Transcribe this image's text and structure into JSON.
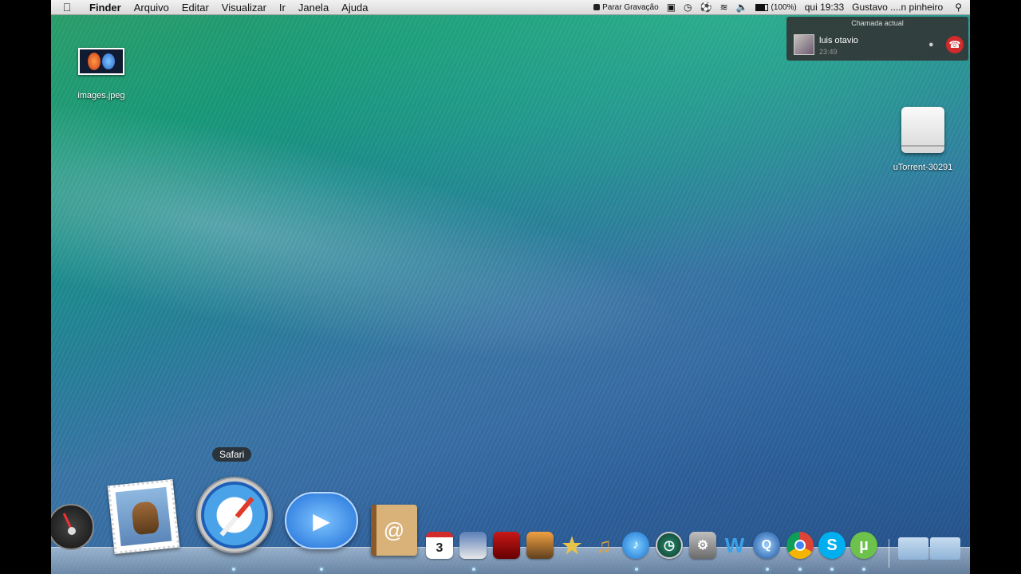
{
  "menubar": {
    "apple_icon": "apple-icon",
    "app": "Finder",
    "items": [
      "Arquivo",
      "Editar",
      "Visualizar",
      "Ir",
      "Janela",
      "Ajuda"
    ],
    "record": "Parar Gravação",
    "battery": "(100%)",
    "clock": "qui 19:33",
    "user": "Gustavo ....n pinheiro"
  },
  "notification": {
    "header": "Chamada actual",
    "name": "luis otavio",
    "time": "23:49"
  },
  "desktop": {
    "image_file": "images.jpeg",
    "drive": "uTorrent-30291"
  },
  "dock": {
    "tooltip": "Safari",
    "calendar_day": "3",
    "skype_letter": "S",
    "wiki_letter": "W",
    "utorrent_letter": "µ"
  },
  "colors": {
    "hangup": "#d12b2b",
    "menubar": "#e6e6e6"
  }
}
